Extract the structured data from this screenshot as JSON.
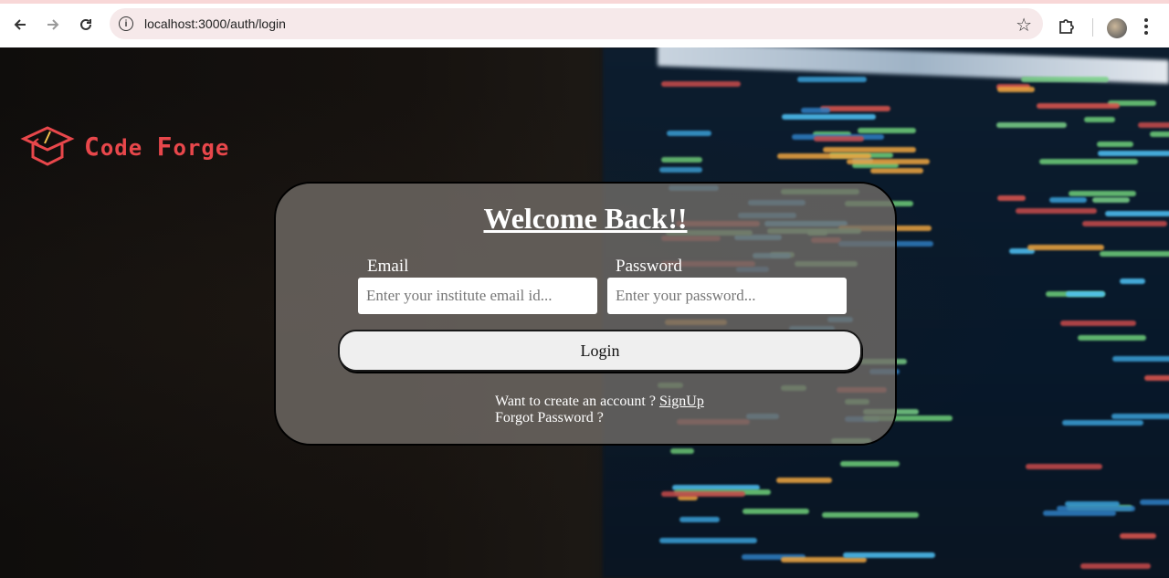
{
  "browser": {
    "url": "localhost:3000/auth/login",
    "back_icon": "arrow-left-icon",
    "forward_icon": "arrow-right-icon",
    "reload_icon": "reload-icon",
    "site_info_icon": "info-icon",
    "bookmark_icon": "star-icon",
    "extensions_icon": "puzzle-icon",
    "menu_icon": "kebab-menu-icon"
  },
  "logo": {
    "text_first_initial": "C",
    "text_first_rest": "ode ",
    "text_second_initial": "F",
    "text_second_rest": "orge",
    "color": "#e8474b"
  },
  "login": {
    "title": "Welcome Back!!",
    "email_label": "Email",
    "email_placeholder": "Enter your institute email id...",
    "password_label": "Password",
    "password_placeholder": "Enter your password...",
    "login_button": "Login",
    "signup_prompt": "Want to create an account ? ",
    "signup_link": "SignUp",
    "forgot_password": "Forgot Password ?"
  }
}
